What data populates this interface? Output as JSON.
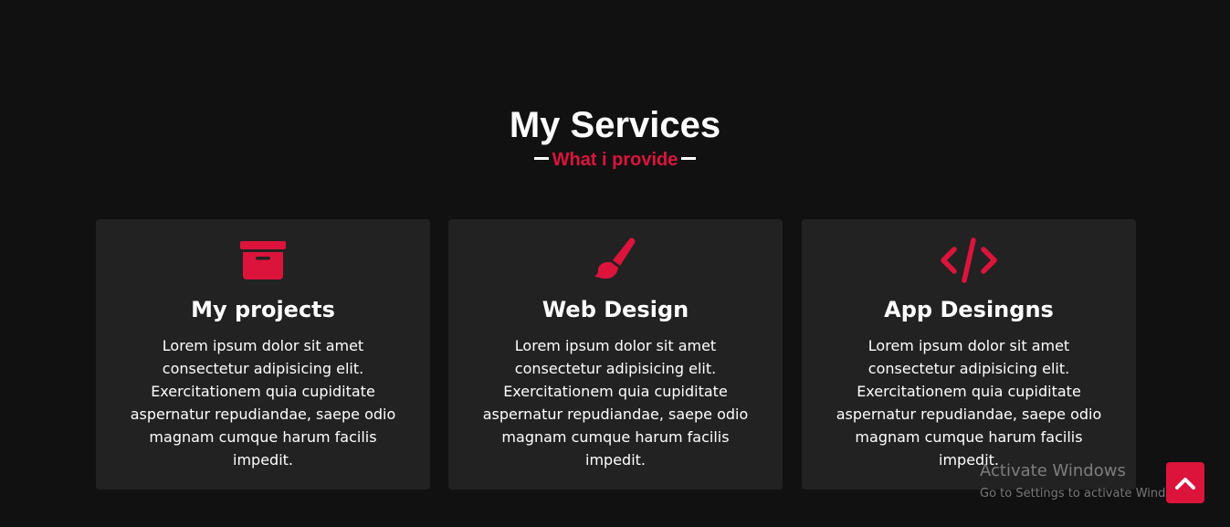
{
  "section": {
    "title": "My Services",
    "subtitle": "What i provide"
  },
  "colors": {
    "background": "#111111",
    "card": "#222222",
    "accent": "#dc143c",
    "text": "#ffffff"
  },
  "services": [
    {
      "icon": "archive-box-icon",
      "title": "My projects",
      "description": "Lorem ipsum dolor sit amet consectetur adipisicing elit. Exercitationem quia cupiditate aspernatur repudiandae, saepe odio magnam cumque harum facilis impedit."
    },
    {
      "icon": "paint-brush-icon",
      "title": "Web Design",
      "description": "Lorem ipsum dolor sit amet consectetur adipisicing elit. Exercitationem quia cupiditate aspernatur repudiandae, saepe odio magnam cumque harum facilis impedit."
    },
    {
      "icon": "code-icon",
      "title": "App Desingns",
      "description": "Lorem ipsum dolor sit amet consectetur adipisicing elit. Exercitationem quia cupiditate aspernatur repudiandae, saepe odio magnam cumque harum facilis impedit."
    }
  ],
  "watermark": {
    "title": "Activate Windows",
    "subtitle": "Go to Settings to activate Windows."
  },
  "scroll_top": {
    "icon": "chevron-up-icon"
  }
}
